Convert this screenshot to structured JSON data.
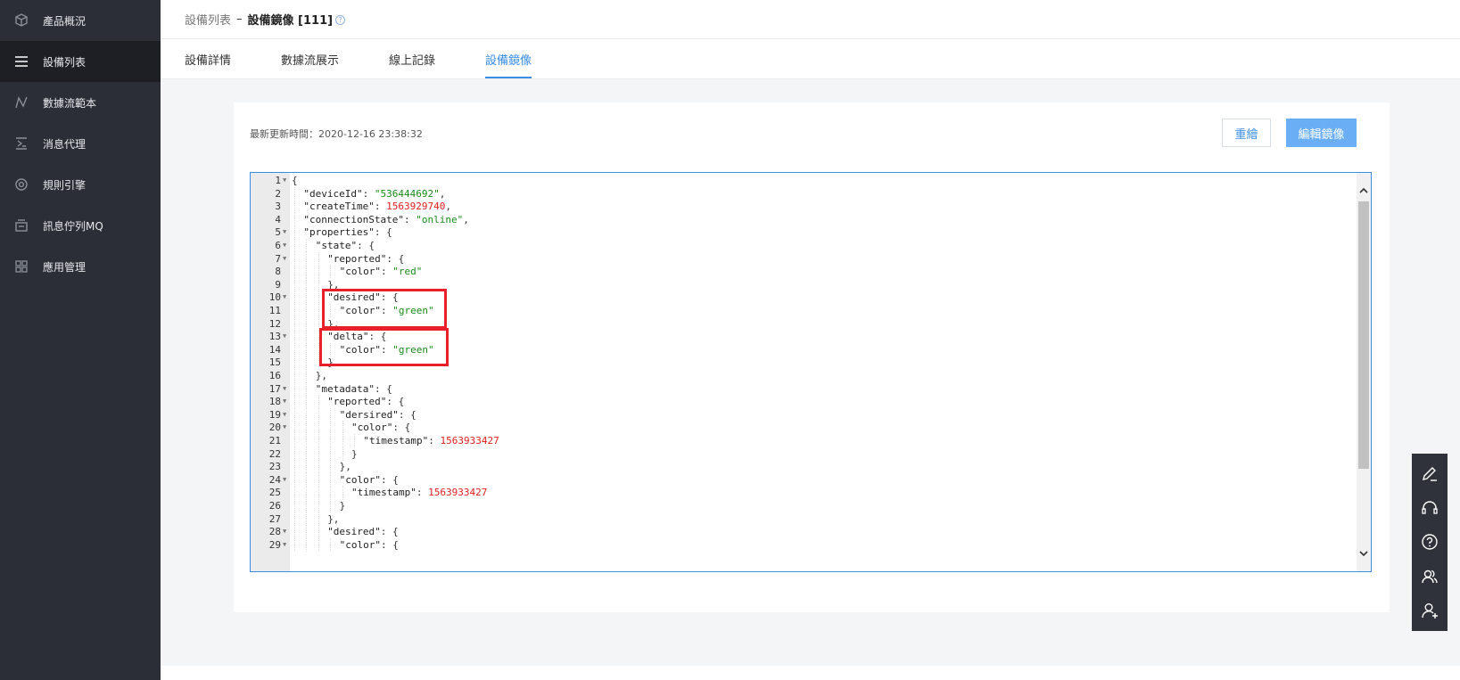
{
  "sidebar": {
    "items": [
      {
        "label": "產品概況",
        "icon": "cube-icon",
        "active": false
      },
      {
        "label": "設備列表",
        "icon": "list-icon",
        "active": true
      },
      {
        "label": "數據流範本",
        "icon": "dataflow-icon",
        "active": false
      },
      {
        "label": "消息代理",
        "icon": "broker-icon",
        "active": false
      },
      {
        "label": "規則引擎",
        "icon": "rule-engine-icon",
        "active": false
      },
      {
        "label": "訊息佇列MQ",
        "icon": "message-queue-icon",
        "active": false
      },
      {
        "label": "應用管理",
        "icon": "apps-grid-icon",
        "active": false
      }
    ]
  },
  "breadcrumb": {
    "parent": "設備列表",
    "separator": "–",
    "current": "設備鏡像 [111]",
    "help": "?"
  },
  "tabs": [
    {
      "label": "設備詳情",
      "active": false
    },
    {
      "label": "數據流展示",
      "active": false
    },
    {
      "label": "線上記錄",
      "active": false
    },
    {
      "label": "設備鏡像",
      "active": true
    }
  ],
  "card": {
    "updated_text": "最新更新時間：2020-12-16 23:38:32",
    "reset_label": "重繪",
    "edit_label": "編輯鏡像"
  },
  "editor": {
    "lines": [
      {
        "n": "1",
        "fold": true,
        "indent": 0,
        "tokens": [
          [
            "p",
            "{"
          ]
        ]
      },
      {
        "n": "2",
        "fold": false,
        "indent": 1,
        "tokens": [
          [
            "k",
            "\"deviceId\""
          ],
          [
            "p",
            ": "
          ],
          [
            "s",
            "\"536444692\""
          ],
          [
            "p",
            ","
          ]
        ]
      },
      {
        "n": "3",
        "fold": false,
        "indent": 1,
        "tokens": [
          [
            "k",
            "\"createTime\""
          ],
          [
            "p",
            ": "
          ],
          [
            "n",
            "1563929740"
          ],
          [
            "p",
            ","
          ]
        ]
      },
      {
        "n": "4",
        "fold": false,
        "indent": 1,
        "tokens": [
          [
            "k",
            "\"connectionState\""
          ],
          [
            "p",
            ": "
          ],
          [
            "s",
            "\"online\""
          ],
          [
            "p",
            ","
          ]
        ]
      },
      {
        "n": "5",
        "fold": true,
        "indent": 1,
        "tokens": [
          [
            "k",
            "\"properties\""
          ],
          [
            "p",
            ": {"
          ]
        ]
      },
      {
        "n": "6",
        "fold": true,
        "indent": 2,
        "tokens": [
          [
            "k",
            "\"state\""
          ],
          [
            "p",
            ": {"
          ]
        ]
      },
      {
        "n": "7",
        "fold": true,
        "indent": 3,
        "tokens": [
          [
            "k",
            "\"reported\""
          ],
          [
            "p",
            ": {"
          ]
        ]
      },
      {
        "n": "8",
        "fold": false,
        "indent": 4,
        "tokens": [
          [
            "k",
            "\"color\""
          ],
          [
            "p",
            ": "
          ],
          [
            "s",
            "\"red\""
          ]
        ]
      },
      {
        "n": "9",
        "fold": false,
        "indent": 3,
        "tokens": [
          [
            "p",
            "},"
          ]
        ]
      },
      {
        "n": "10",
        "fold": true,
        "indent": 3,
        "tokens": [
          [
            "k",
            "\"desired\""
          ],
          [
            "p",
            ": {"
          ]
        ]
      },
      {
        "n": "11",
        "fold": false,
        "indent": 4,
        "tokens": [
          [
            "k",
            "\"color\""
          ],
          [
            "p",
            ": "
          ],
          [
            "s",
            "\"green\""
          ]
        ]
      },
      {
        "n": "12",
        "fold": false,
        "indent": 3,
        "tokens": [
          [
            "p",
            "},"
          ]
        ]
      },
      {
        "n": "13",
        "fold": true,
        "indent": 3,
        "tokens": [
          [
            "k",
            "\"delta\""
          ],
          [
            "p",
            ": {"
          ]
        ]
      },
      {
        "n": "14",
        "fold": false,
        "indent": 4,
        "tokens": [
          [
            "k",
            "\"color\""
          ],
          [
            "p",
            ": "
          ],
          [
            "s",
            "\"green\""
          ]
        ]
      },
      {
        "n": "15",
        "fold": false,
        "indent": 3,
        "tokens": [
          [
            "p",
            "}"
          ]
        ]
      },
      {
        "n": "16",
        "fold": false,
        "indent": 2,
        "tokens": [
          [
            "p",
            "},"
          ]
        ]
      },
      {
        "n": "17",
        "fold": true,
        "indent": 2,
        "tokens": [
          [
            "k",
            "\"metadata\""
          ],
          [
            "p",
            ": {"
          ]
        ]
      },
      {
        "n": "18",
        "fold": true,
        "indent": 3,
        "tokens": [
          [
            "k",
            "\"reported\""
          ],
          [
            "p",
            ": {"
          ]
        ]
      },
      {
        "n": "19",
        "fold": true,
        "indent": 4,
        "tokens": [
          [
            "k",
            "\"dersired\""
          ],
          [
            "p",
            ": {"
          ]
        ]
      },
      {
        "n": "20",
        "fold": true,
        "indent": 5,
        "tokens": [
          [
            "k",
            "\"color\""
          ],
          [
            "p",
            ": {"
          ]
        ]
      },
      {
        "n": "21",
        "fold": false,
        "indent": 6,
        "tokens": [
          [
            "k",
            "\"timestamp\""
          ],
          [
            "p",
            ": "
          ],
          [
            "n",
            "1563933427"
          ]
        ]
      },
      {
        "n": "22",
        "fold": false,
        "indent": 5,
        "tokens": [
          [
            "p",
            "}"
          ]
        ]
      },
      {
        "n": "23",
        "fold": false,
        "indent": 4,
        "tokens": [
          [
            "p",
            "},"
          ]
        ]
      },
      {
        "n": "24",
        "fold": true,
        "indent": 4,
        "tokens": [
          [
            "k",
            "\"color\""
          ],
          [
            "p",
            ": {"
          ]
        ]
      },
      {
        "n": "25",
        "fold": false,
        "indent": 5,
        "tokens": [
          [
            "k",
            "\"timestamp\""
          ],
          [
            "p",
            ": "
          ],
          [
            "n",
            "1563933427"
          ]
        ]
      },
      {
        "n": "26",
        "fold": false,
        "indent": 4,
        "tokens": [
          [
            "p",
            "}"
          ]
        ]
      },
      {
        "n": "27",
        "fold": false,
        "indent": 3,
        "tokens": [
          [
            "p",
            "},"
          ]
        ]
      },
      {
        "n": "28",
        "fold": true,
        "indent": 3,
        "tokens": [
          [
            "k",
            "\"desired\""
          ],
          [
            "p",
            ": {"
          ]
        ]
      },
      {
        "n": "29",
        "fold": true,
        "indent": 4,
        "tokens": [
          [
            "k",
            "\"color\""
          ],
          [
            "p",
            ": {"
          ]
        ]
      }
    ]
  },
  "floatbar": {
    "items": [
      {
        "icon": "edit-pen-icon"
      },
      {
        "icon": "headset-icon"
      },
      {
        "icon": "help-circle-icon"
      },
      {
        "icon": "users-icon"
      },
      {
        "icon": "add-user-icon"
      }
    ]
  },
  "colors": {
    "sidebar_bg": "#2b2e36",
    "accent": "#3a8ee6",
    "string": "#1a8a1a",
    "number": "#e02020",
    "highlight": "#e8202a"
  }
}
